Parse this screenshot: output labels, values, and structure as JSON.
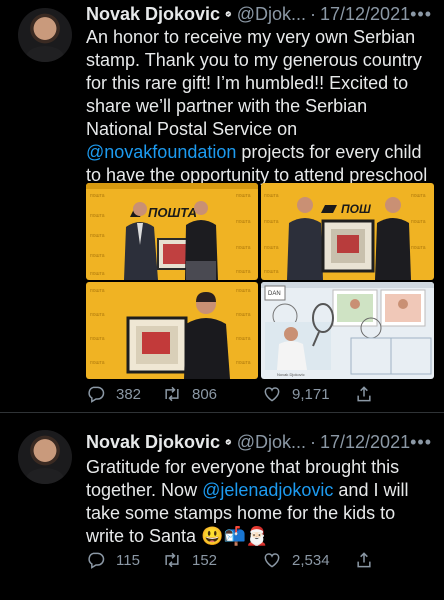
{
  "tweets": [
    {
      "author_name": "Novak Djokovic",
      "handle": "@Djok...",
      "separator": "·",
      "date": "17/12/2021",
      "text_1": "An honor to receive my very own Serbian stamp. Thank you to my generous country for this rare gift! I’m humbled!! Excited to share we’ll partner with the Serbian National Postal Service on ",
      "mention": "@novakfoundation",
      "text_2": " projects for every child to have the opportunity to attend preschool 🙏🏼",
      "replies": "382",
      "retweets": "806",
      "likes": "9,171"
    },
    {
      "author_name": "Novak Djokovic",
      "handle": "@Djok...",
      "separator": "·",
      "date": "17/12/2021",
      "text_1": "Gratitude for everyone that brought this together. Now ",
      "mention": "@jelenadjokovic",
      "text_2": " and I will take some stamps home for the kids to write to Santa 😃📬🎅🏻",
      "replies": "115",
      "retweets": "152",
      "likes": "2,534"
    }
  ],
  "media": {
    "banner_text": "ПОШТА",
    "stamp_badge": "DAN",
    "stamp_caption": "Novak Djokovic"
  },
  "icons": {
    "verified": "verified-badge-icon",
    "more": "more-dots-icon",
    "reply": "reply-icon",
    "retweet": "retweet-icon",
    "like": "heart-icon",
    "share": "share-icon"
  },
  "colors": {
    "background": "#000000",
    "text": "#e7e9ea",
    "muted": "#8b98a5",
    "link": "#1d9bf0",
    "divider": "#2f3336"
  }
}
